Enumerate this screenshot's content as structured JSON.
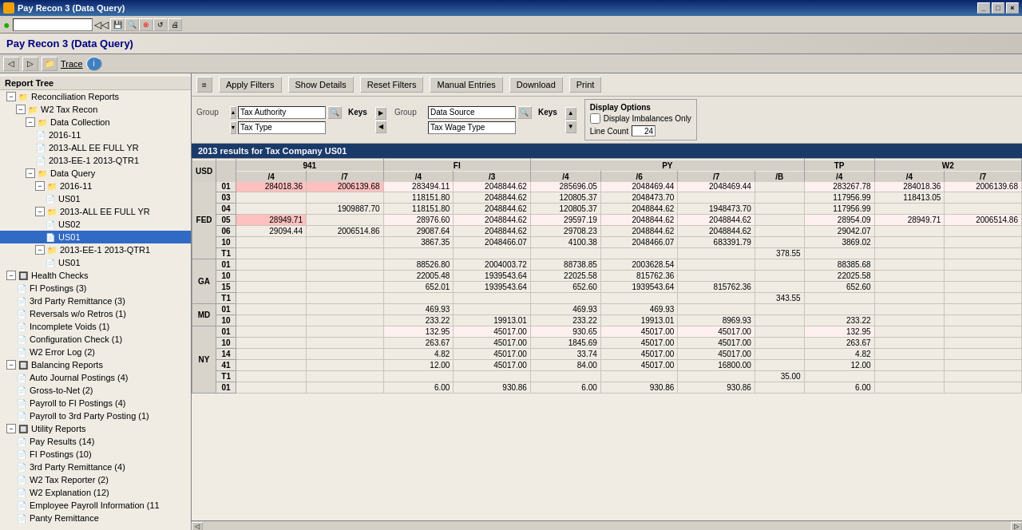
{
  "titleBar": {
    "title": "Pay Recon 3 (Data Query)",
    "buttons": [
      "_",
      "□",
      "×"
    ]
  },
  "appTitle": "Pay Recon 3 (Data Query)",
  "toolbar": {
    "traceLabel": "Trace",
    "infoLabel": "i"
  },
  "filters": {
    "applyLabel": "Apply Filters",
    "showDetailsLabel": "Show Details",
    "resetLabel": "Reset Filters",
    "manualLabel": "Manual Entries",
    "downloadLabel": "Download",
    "printLabel": "Print",
    "group1Label": "Group",
    "group1Value": "Tax Authority",
    "keys1Label": "Keys",
    "group1sub": "Tax Type",
    "group2Label": "Group",
    "group2Value": "Data Source",
    "keys2Label": "Keys",
    "group2sub": "Tax Wage Type",
    "displayOptions": {
      "title": "Display Options",
      "imbalancesLabel": "Display Imbalances Only",
      "lineCountLabel": "Line Count",
      "lineCountValue": "24"
    }
  },
  "resultHeader": "2013 results for Tax Company US01",
  "tree": {
    "header": "Report Tree",
    "items": [
      {
        "label": "Reconciliation Reports",
        "level": 0,
        "type": "folder",
        "expanded": true
      },
      {
        "label": "W2 Tax Recon",
        "level": 1,
        "type": "folder",
        "expanded": true
      },
      {
        "label": "Data Collection",
        "level": 2,
        "type": "folder",
        "expanded": true
      },
      {
        "label": "2016-11",
        "level": 3,
        "type": "doc"
      },
      {
        "label": "2013-ALL EE FULL YR",
        "level": 3,
        "type": "doc"
      },
      {
        "label": "2013-EE-1 2013-QTR1",
        "level": 3,
        "type": "doc"
      },
      {
        "label": "Data Query",
        "level": 2,
        "type": "folder",
        "expanded": true
      },
      {
        "label": "2016-11",
        "level": 3,
        "type": "folder",
        "expanded": true
      },
      {
        "label": "US01",
        "level": 4,
        "type": "doc"
      },
      {
        "label": "2013-ALL EE FULL YR",
        "level": 3,
        "type": "folder",
        "expanded": true
      },
      {
        "label": "US02",
        "level": 4,
        "type": "doc"
      },
      {
        "label": "US01",
        "level": 4,
        "type": "doc",
        "selected": true
      },
      {
        "label": "2013-EE-1 2013-QTR1",
        "level": 3,
        "type": "folder",
        "expanded": true
      },
      {
        "label": "US01",
        "level": 4,
        "type": "doc"
      },
      {
        "label": "Health Checks",
        "level": 0,
        "type": "folder",
        "expanded": true
      },
      {
        "label": "FI Postings (3)",
        "level": 1,
        "type": "doc"
      },
      {
        "label": "3rd Party Remittance (3)",
        "level": 1,
        "type": "doc"
      },
      {
        "label": "Reversals w/o Retros (1)",
        "level": 1,
        "type": "doc"
      },
      {
        "label": "Incomplete Voids (1)",
        "level": 1,
        "type": "doc"
      },
      {
        "label": "Configuration Check (1)",
        "level": 1,
        "type": "doc"
      },
      {
        "label": "W2 Error Log (2)",
        "level": 1,
        "type": "doc"
      },
      {
        "label": "Balancing Reports",
        "level": 0,
        "type": "folder",
        "expanded": true
      },
      {
        "label": "Auto Journal Postings (4)",
        "level": 1,
        "type": "doc"
      },
      {
        "label": "Gross-to-Net (2)",
        "level": 1,
        "type": "doc"
      },
      {
        "label": "Payroll to FI Postings (4)",
        "level": 1,
        "type": "doc"
      },
      {
        "label": "Payroll to 3rd Party Posting (1)",
        "level": 1,
        "type": "doc"
      },
      {
        "label": "Utility Reports",
        "level": 0,
        "type": "folder",
        "expanded": true
      },
      {
        "label": "Pay Results (14)",
        "level": 1,
        "type": "doc"
      },
      {
        "label": "FI Postings (10)",
        "level": 1,
        "type": "doc"
      },
      {
        "label": "3rd Party Remittance (4)",
        "level": 1,
        "type": "doc"
      },
      {
        "label": "W2 Tax Reporter (2)",
        "level": 1,
        "type": "doc"
      },
      {
        "label": "W2 Explanation (12)",
        "level": 1,
        "type": "doc"
      },
      {
        "label": "Employee Payroll Information (11",
        "level": 1,
        "type": "doc"
      },
      {
        "label": "Panty Remittance",
        "level": 1,
        "type": "doc"
      }
    ]
  },
  "tableHeaders": {
    "usd": "USD",
    "col941": "941",
    "colFI": "FI",
    "colPY": "PY",
    "colTP": "TP",
    "colW2": "W2",
    "sub4a": "/4",
    "sub7a": "/7",
    "sub4b": "/4",
    "sub3": "/3",
    "sub4c": "/4",
    "sub6": "/6",
    "sub7b": "/7",
    "subB": "/B",
    "sub4d": "/4",
    "sub4e": "/4",
    "sub7c": "/7"
  },
  "tableData": [
    {
      "group": "FED",
      "row": "01",
      "c1": "284018.36",
      "c2": "2006139.68",
      "c3": "283494.11",
      "c4": "2048844.62",
      "c5": "285696.05",
      "c6": "2048469.44",
      "c7": "2048469.44",
      "c8": "",
      "c9": "283267.78",
      "c10": "284018.36",
      "c11": "2006139.68",
      "highlight": true
    },
    {
      "group": "",
      "row": "03",
      "c1": "",
      "c2": "",
      "c3": "118151.80",
      "c4": "2048844.62",
      "c5": "120805.37",
      "c6": "2048473.70",
      "c7": "",
      "c8": "",
      "c9": "117956.99",
      "c10": "118413.05",
      "c11": "",
      "highlight": false
    },
    {
      "group": "",
      "row": "04",
      "c1": "",
      "c2": "1909887.70",
      "c3": "118151.80",
      "c4": "2048844.62",
      "c5": "120805.37",
      "c6": "2048844.62",
      "c7": "1948473.70",
      "c8": "",
      "c9": "117956.99",
      "c10": "",
      "c11": "",
      "highlight": false
    },
    {
      "group": "",
      "row": "05",
      "c1": "28949.71",
      "c2": "",
      "c3": "28976.60",
      "c4": "2048844.62",
      "c5": "29597.19",
      "c6": "2048844.62",
      "c7": "2048844.62",
      "c8": "",
      "c9": "28954.09",
      "c10": "28949.71",
      "c11": "2006514.86",
      "highlight": true
    },
    {
      "group": "",
      "row": "06",
      "c1": "29094.44",
      "c2": "2006514.86",
      "c3": "29087.64",
      "c4": "2048844.62",
      "c5": "29708.23",
      "c6": "2048844.62",
      "c7": "2048844.62",
      "c8": "",
      "c9": "29042.07",
      "c10": "",
      "c11": "",
      "highlight": false
    },
    {
      "group": "",
      "row": "10",
      "c1": "",
      "c2": "",
      "c3": "3867.35",
      "c4": "2048466.07",
      "c5": "4100.38",
      "c6": "2048466.07",
      "c7": "683391.79",
      "c8": "",
      "c9": "3869.02",
      "c10": "",
      "c11": "",
      "highlight": false
    },
    {
      "group": "",
      "row": "T1",
      "c1": "",
      "c2": "",
      "c3": "",
      "c4": "",
      "c5": "",
      "c6": "",
      "c7": "",
      "c8": "378.55",
      "c9": "",
      "c10": "",
      "c11": "",
      "highlight": false
    },
    {
      "group": "GA",
      "row": "01",
      "c1": "",
      "c2": "",
      "c3": "88526.80",
      "c4": "2004003.72",
      "c5": "88738.85",
      "c6": "2003628.54",
      "c7": "",
      "c8": "",
      "c9": "88385.68",
      "c10": "",
      "c11": "",
      "highlight": false
    },
    {
      "group": "",
      "row": "10",
      "c1": "",
      "c2": "",
      "c3": "22005.48",
      "c4": "1939543.64",
      "c5": "22025.58",
      "c6": "815762.36",
      "c7": "",
      "c8": "",
      "c9": "22025.58",
      "c10": "",
      "c11": "",
      "highlight": false
    },
    {
      "group": "",
      "row": "15",
      "c1": "",
      "c2": "",
      "c3": "652.01",
      "c4": "1939543.64",
      "c5": "652.60",
      "c6": "1939543.64",
      "c7": "815762.36",
      "c8": "",
      "c9": "652.60",
      "c10": "",
      "c11": "",
      "highlight": false
    },
    {
      "group": "",
      "row": "T1",
      "c1": "",
      "c2": "",
      "c3": "",
      "c4": "",
      "c5": "",
      "c6": "",
      "c7": "",
      "c8": "343.55",
      "c9": "",
      "c10": "",
      "c11": "",
      "highlight": false
    },
    {
      "group": "MD",
      "row": "01",
      "c1": "",
      "c2": "",
      "c3": "469.93",
      "c4": "",
      "c5": "469.93",
      "c6": "469.93",
      "c7": "",
      "c8": "",
      "c9": "",
      "c10": "",
      "c11": "",
      "highlight": false
    },
    {
      "group": "",
      "row": "10",
      "c1": "",
      "c2": "",
      "c3": "233.22",
      "c4": "19913.01",
      "c5": "233.22",
      "c6": "19913.01",
      "c7": "8969.93",
      "c8": "",
      "c9": "233.22",
      "c10": "",
      "c11": "",
      "highlight": false
    },
    {
      "group": "NY",
      "row": "01",
      "c1": "",
      "c2": "",
      "c3": "132.95",
      "c4": "45017.00",
      "c5": "930.65",
      "c6": "45017.00",
      "c7": "45017.00",
      "c8": "",
      "c9": "132.95",
      "c10": "",
      "c11": "",
      "highlight": true
    },
    {
      "group": "",
      "row": "10",
      "c1": "",
      "c2": "",
      "c3": "263.67",
      "c4": "45017.00",
      "c5": "1845.69",
      "c6": "45017.00",
      "c7": "45017.00",
      "c8": "",
      "c9": "263.67",
      "c10": "",
      "c11": "",
      "highlight": false
    },
    {
      "group": "",
      "row": "14",
      "c1": "",
      "c2": "",
      "c3": "4.82",
      "c4": "45017.00",
      "c5": "33.74",
      "c6": "45017.00",
      "c7": "45017.00",
      "c8": "",
      "c9": "4.82",
      "c10": "",
      "c11": "",
      "highlight": false
    },
    {
      "group": "",
      "row": "41",
      "c1": "",
      "c2": "",
      "c3": "12.00",
      "c4": "45017.00",
      "c5": "84.00",
      "c6": "45017.00",
      "c7": "16800.00",
      "c8": "",
      "c9": "12.00",
      "c10": "",
      "c11": "",
      "highlight": false
    },
    {
      "group": "",
      "row": "T1",
      "c1": "",
      "c2": "",
      "c3": "",
      "c4": "",
      "c5": "",
      "c6": "",
      "c7": "",
      "c8": "35.00",
      "c9": "",
      "c10": "",
      "c11": "",
      "highlight": false
    },
    {
      "group": "",
      "row": "01",
      "c1": "",
      "c2": "",
      "c3": "6.00",
      "c4": "930.86",
      "c5": "6.00",
      "c6": "930.86",
      "c7": "930.86",
      "c8": "",
      "c9": "6.00",
      "c10": "",
      "c11": "",
      "highlight": false
    }
  ]
}
